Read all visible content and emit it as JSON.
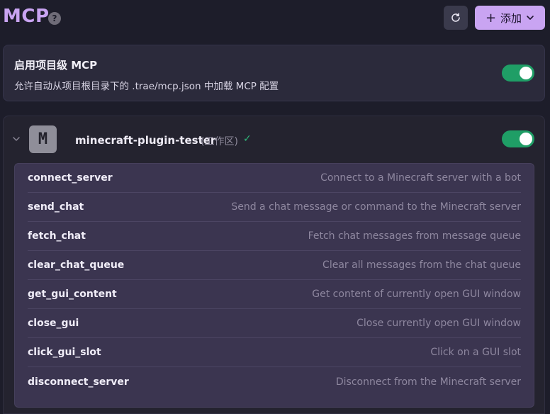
{
  "header": {
    "title": "MCP",
    "help_icon": "?",
    "refresh_icon": "refresh-icon",
    "add_label": "添加",
    "add_icon": "+"
  },
  "project_mcp": {
    "title": "启用项目级 MCP",
    "description": "允许自动从项目根目录下的 .trae/mcp.json 中加载 MCP 配置",
    "enabled": true
  },
  "server": {
    "avatar_letter": "M",
    "name": "minecraft-plugin-tester",
    "scope": "(工作区)",
    "status_icon": "✓",
    "enabled": true,
    "tools": [
      {
        "name": "connect_server",
        "description": "Connect to a Minecraft server with a bot"
      },
      {
        "name": "send_chat",
        "description": "Send a chat message or command to the Minecraft server"
      },
      {
        "name": "fetch_chat",
        "description": "Fetch chat messages from message queue"
      },
      {
        "name": "clear_chat_queue",
        "description": "Clear all messages from the chat queue"
      },
      {
        "name": "get_gui_content",
        "description": "Get content of currently open GUI window"
      },
      {
        "name": "close_gui",
        "description": "Close currently open GUI window"
      },
      {
        "name": "click_gui_slot",
        "description": "Click on a GUI slot"
      },
      {
        "name": "disconnect_server",
        "description": "Disconnect from the Minecraft server"
      }
    ]
  },
  "colors": {
    "accent": "#c9a4f2",
    "toggle_on": "#1f9e66",
    "background": "#1d1d2a"
  }
}
